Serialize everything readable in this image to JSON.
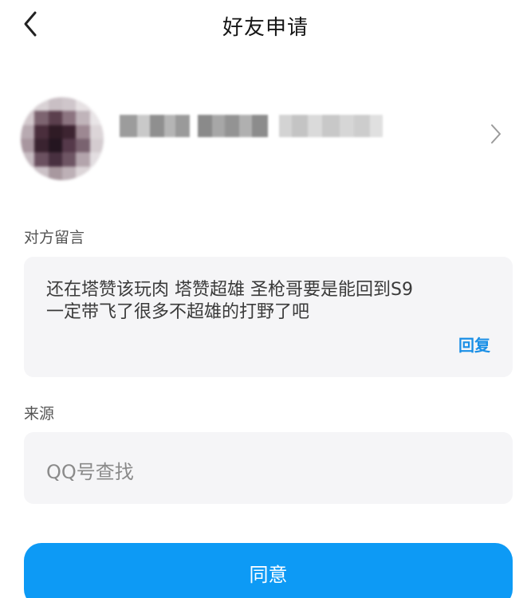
{
  "header": {
    "title": "好友申请"
  },
  "message_section": {
    "label": "对方留言",
    "text": "还在塔赞该玩肉 塔赞超雄 圣枪哥要是能回到S9一定带飞了很多不超雄的打野了吧",
    "reply_label": "回复"
  },
  "source_section": {
    "label": "来源",
    "value": "QQ号查找"
  },
  "actions": {
    "agree_label": "同意"
  },
  "colors": {
    "accent": "#0d9af5",
    "link": "#1a8fe6",
    "box_bg": "#f5f5f7"
  },
  "icons": {
    "back": "chevron-left-icon",
    "profile_arrow": "chevron-right-icon"
  }
}
